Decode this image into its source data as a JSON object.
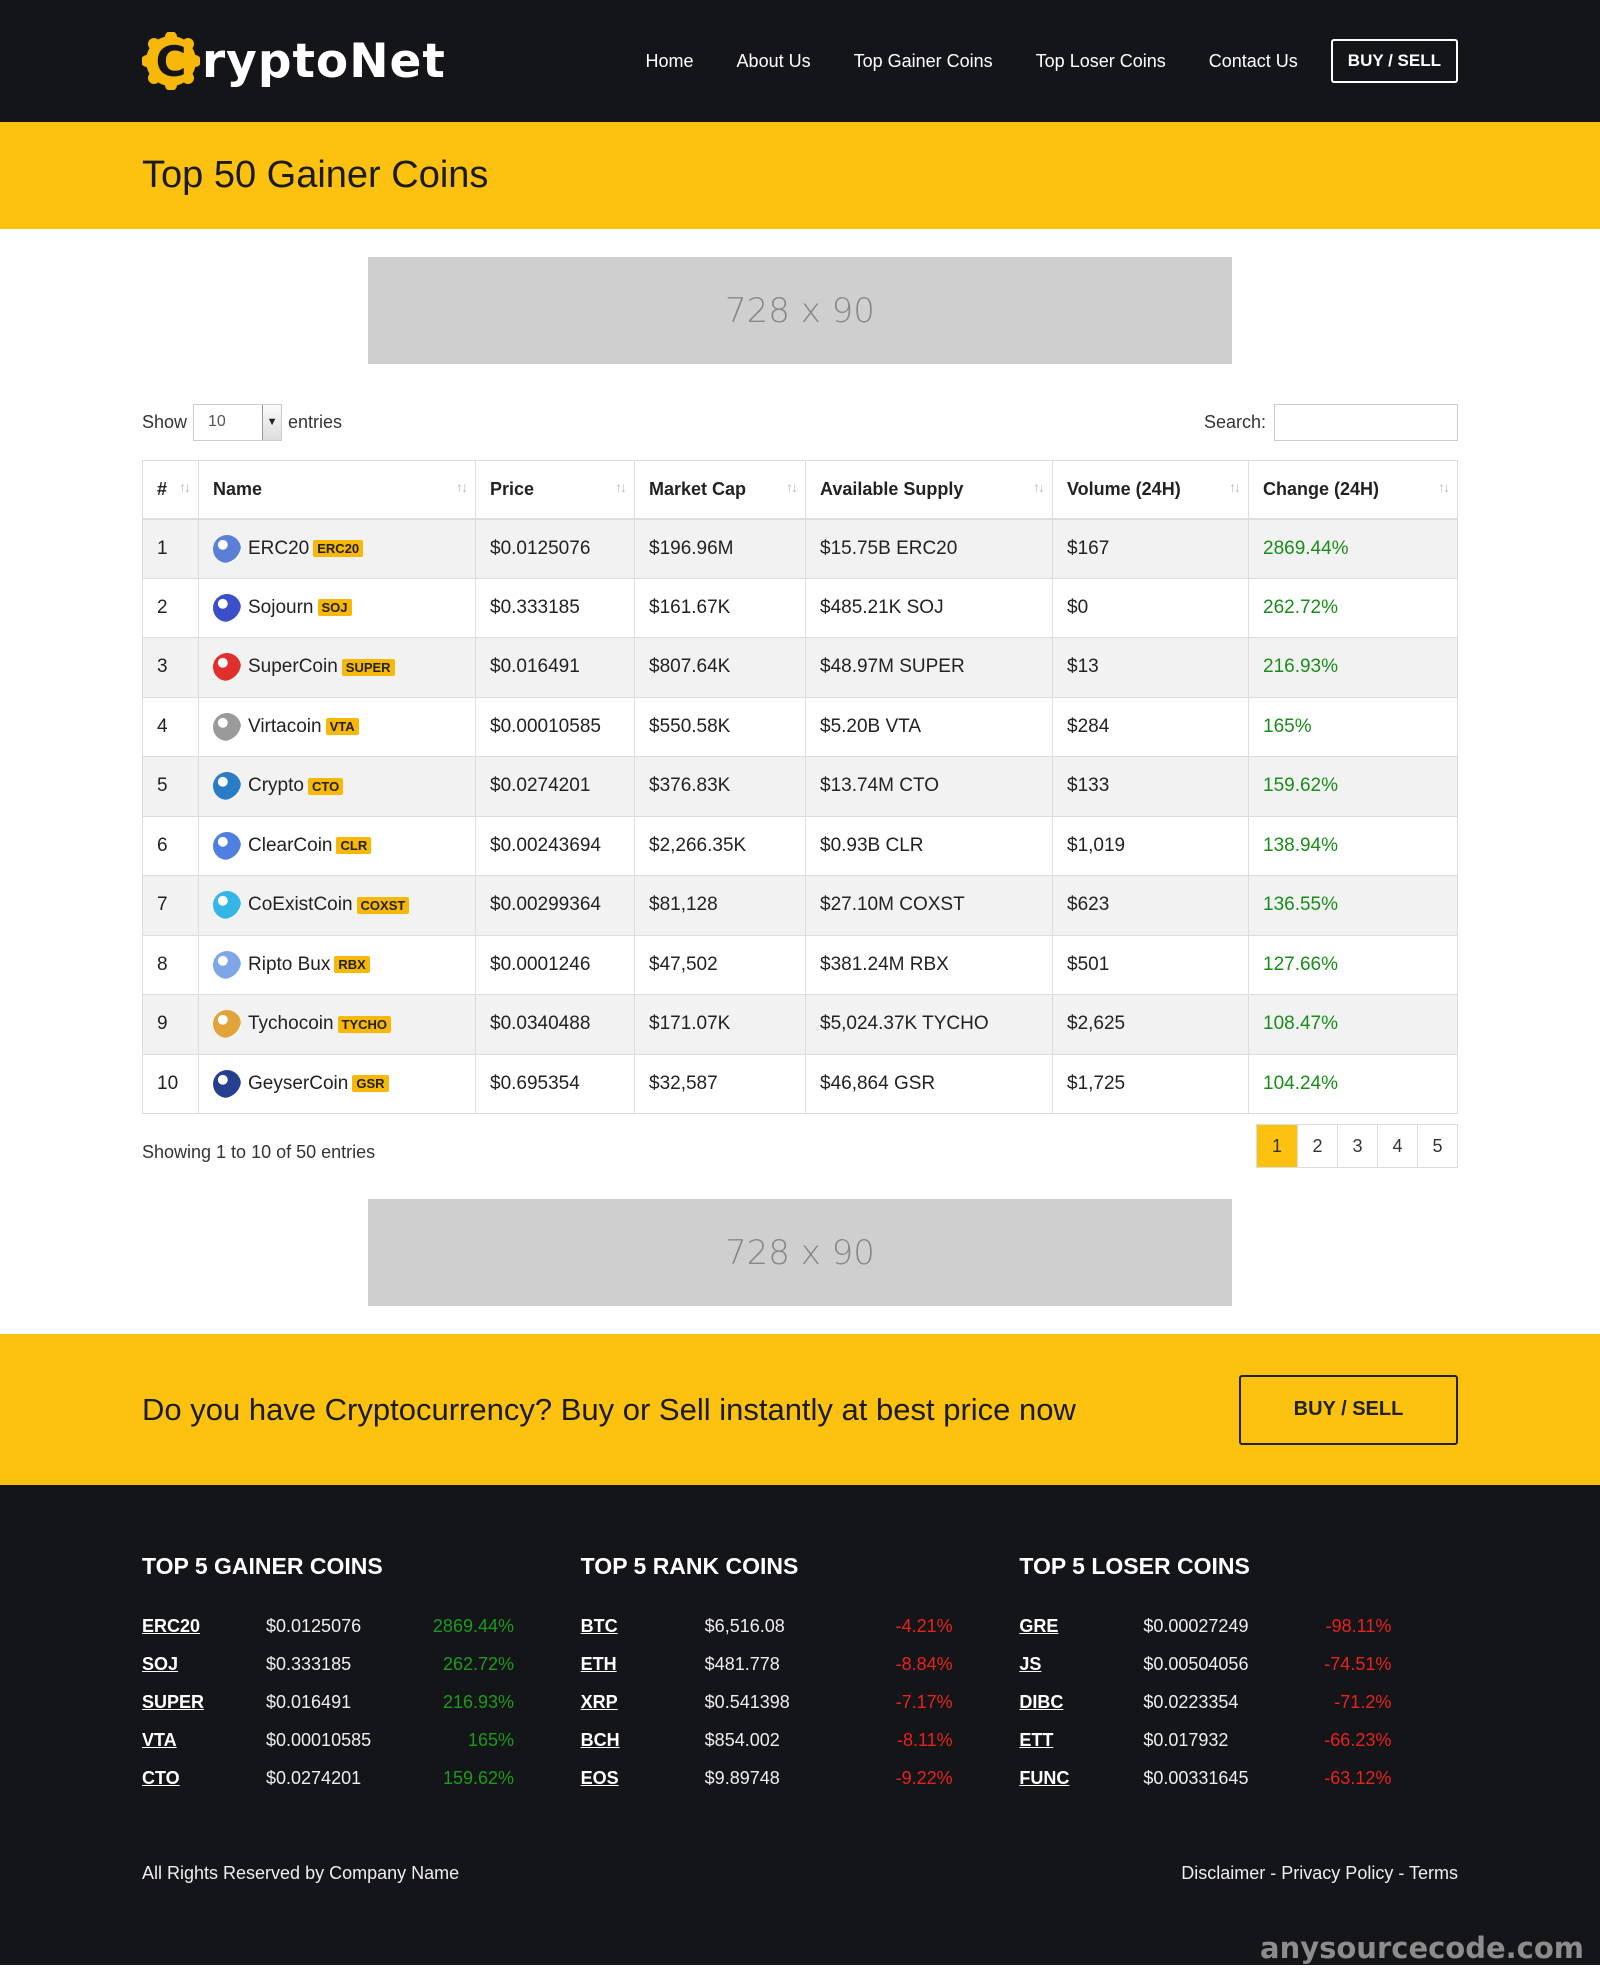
{
  "brand": {
    "name": "ryptoNet",
    "logo_letter": "C"
  },
  "nav": {
    "items": [
      "Home",
      "About Us",
      "Top Gainer Coins",
      "Top Loser Coins",
      "Contact Us"
    ],
    "buy_sell": "BUY / SELL"
  },
  "page_title": "Top 50 Gainer Coins",
  "ads": {
    "top": "728 x 90",
    "bottom": "728 x 90"
  },
  "controls": {
    "show_label": "Show",
    "entries_value": "10",
    "entries_label": "entries",
    "search_label": "Search:"
  },
  "table": {
    "headers": [
      "#",
      "Name",
      "Price",
      "Market Cap",
      "Available Supply",
      "Volume (24H)",
      "Change (24H)"
    ],
    "rows": [
      {
        "rank": "1",
        "name": "ERC20",
        "sym": "ERC20",
        "price": "$0.0125076",
        "cap": "$196.96M",
        "supply": "$15.75B ERC20",
        "volume": "$167",
        "change": "2869.44%",
        "icon_color": "#5b7fd6"
      },
      {
        "rank": "2",
        "name": "Sojourn",
        "sym": "SOJ",
        "price": "$0.333185",
        "cap": "$161.67K",
        "supply": "$485.21K SOJ",
        "volume": "$0",
        "change": "262.72%",
        "icon_color": "#3a4fc9"
      },
      {
        "rank": "3",
        "name": "SuperCoin",
        "sym": "SUPER",
        "price": "$0.016491",
        "cap": "$807.64K",
        "supply": "$48.97M SUPER",
        "volume": "$13",
        "change": "216.93%",
        "icon_color": "#e0302c"
      },
      {
        "rank": "4",
        "name": "Virtacoin",
        "sym": "VTA",
        "price": "$0.00010585",
        "cap": "$550.58K",
        "supply": "$5.20B VTA",
        "volume": "$284",
        "change": "165%",
        "icon_color": "#9a9a9a"
      },
      {
        "rank": "5",
        "name": "Crypto",
        "sym": "CTO",
        "price": "$0.0274201",
        "cap": "$376.83K",
        "supply": "$13.74M CTO",
        "volume": "$133",
        "change": "159.62%",
        "icon_color": "#2a7cc7"
      },
      {
        "rank": "6",
        "name": "ClearCoin",
        "sym": "CLR",
        "price": "$0.00243694",
        "cap": "$2,266.35K",
        "supply": "$0.93B CLR",
        "volume": "$1,019",
        "change": "138.94%",
        "icon_color": "#4f7fe0"
      },
      {
        "rank": "7",
        "name": "CoExistCoin",
        "sym": "COXST",
        "price": "$0.00299364",
        "cap": "$81,128",
        "supply": "$27.10M COXST",
        "volume": "$623",
        "change": "136.55%",
        "icon_color": "#35b5e8"
      },
      {
        "rank": "8",
        "name": "Ripto Bux",
        "sym": "RBX",
        "price": "$0.0001246",
        "cap": "$47,502",
        "supply": "$381.24M RBX",
        "volume": "$501",
        "change": "127.66%",
        "icon_color": "#7fa7e8"
      },
      {
        "rank": "9",
        "name": "Tychocoin",
        "sym": "TYCHO",
        "price": "$0.0340488",
        "cap": "$171.07K",
        "supply": "$5,024.37K TYCHO",
        "volume": "$2,625",
        "change": "108.47%",
        "icon_color": "#e0a43a"
      },
      {
        "rank": "10",
        "name": "GeyserCoin",
        "sym": "GSR",
        "price": "$0.695354",
        "cap": "$32,587",
        "supply": "$46,864 GSR",
        "volume": "$1,725",
        "change": "104.24%",
        "icon_color": "#25408f"
      }
    ]
  },
  "table_info": "Showing 1 to 10 of 50 entries",
  "pagination": [
    "1",
    "2",
    "3",
    "4",
    "5"
  ],
  "cta": {
    "text": "Do you have Cryptocurrency? Buy or Sell instantly at best price now",
    "button": "BUY / SELL"
  },
  "footer": {
    "gainers": {
      "title": "TOP 5 GAINER COINS",
      "rows": [
        {
          "s": "ERC20",
          "p": "$0.0125076",
          "c": "2869.44%"
        },
        {
          "s": "SOJ",
          "p": "$0.333185",
          "c": "262.72%"
        },
        {
          "s": "SUPER",
          "p": "$0.016491",
          "c": "216.93%"
        },
        {
          "s": "VTA",
          "p": "$0.00010585",
          "c": "165%"
        },
        {
          "s": "CTO",
          "p": "$0.0274201",
          "c": "159.62%"
        }
      ]
    },
    "rank": {
      "title": "TOP 5 RANK COINS",
      "rows": [
        {
          "s": "BTC",
          "p": "$6,516.08",
          "c": "-4.21%"
        },
        {
          "s": "ETH",
          "p": "$481.778",
          "c": "-8.84%"
        },
        {
          "s": "XRP",
          "p": "$0.541398",
          "c": "-7.17%"
        },
        {
          "s": "BCH",
          "p": "$854.002",
          "c": "-8.11%"
        },
        {
          "s": "EOS",
          "p": "$9.89748",
          "c": "-9.22%"
        }
      ]
    },
    "losers": {
      "title": "TOP 5 LOSER COINS",
      "rows": [
        {
          "s": "GRE",
          "p": "$0.00027249",
          "c": "-98.11%"
        },
        {
          "s": "JS",
          "p": "$0.00504056",
          "c": "-74.51%"
        },
        {
          "s": "DIBC",
          "p": "$0.0223354",
          "c": "-71.2%"
        },
        {
          "s": "ETT",
          "p": "$0.017932",
          "c": "-66.23%"
        },
        {
          "s": "FUNC",
          "p": "$0.00331645",
          "c": "-63.12%"
        }
      ]
    },
    "copyright": "All Rights Reserved by Company Name",
    "links": [
      "Disclaimer",
      "Privacy Policy",
      "Terms"
    ],
    "separator": " - "
  },
  "watermark": "anysourcecode.com",
  "colors": {
    "accent": "#fdc10f",
    "dark": "#141518",
    "up": "#1a8c1a",
    "down": "#e8231d"
  }
}
